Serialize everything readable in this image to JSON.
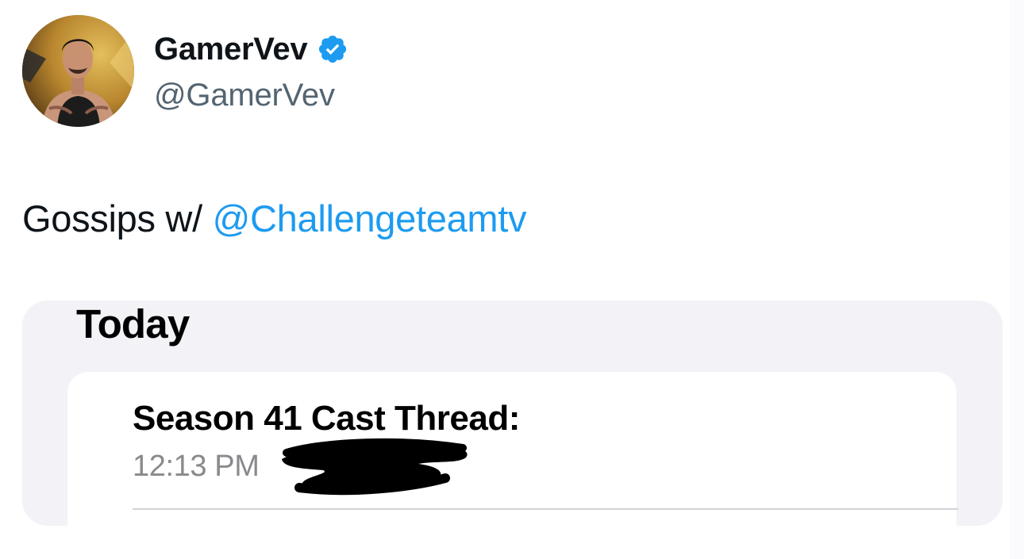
{
  "author": {
    "display_name": "GamerVev",
    "handle": "@GamerVev",
    "verified": true,
    "avatar": "profile-photo"
  },
  "tweet": {
    "text_prefix": "Gossips w/ ",
    "mention": "@Challengeteamtv"
  },
  "media": {
    "section_label": "Today",
    "note": {
      "title": "Season 41 Cast Thread:",
      "time": "12:13 PM",
      "redaction": "scribbled-out-text"
    }
  },
  "colors": {
    "text_primary": "#0f1419",
    "text_secondary": "#536471",
    "link": "#1d9bf0",
    "verified_badge": "#1d9bf0",
    "media_background": "#f2f2f7",
    "note_time": "#8a8a8e"
  },
  "icons": {
    "verified": "verified-badge-icon"
  }
}
